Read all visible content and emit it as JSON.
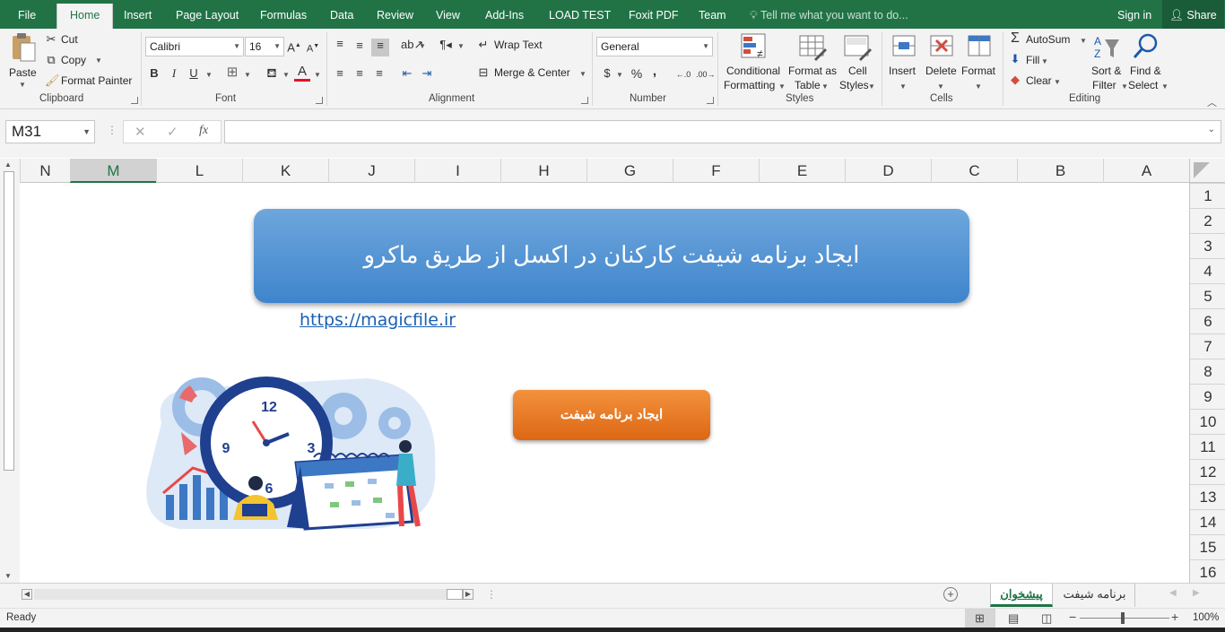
{
  "menu": {
    "tabs": [
      "File",
      "Home",
      "Insert",
      "Page Layout",
      "Formulas",
      "Data",
      "Review",
      "View",
      "Add-Ins",
      "LOAD TEST",
      "Foxit PDF",
      "Team"
    ],
    "active_tab": "Home",
    "tell_me": "Tell me what you want to do...",
    "sign_in": "Sign in",
    "share": "Share"
  },
  "ribbon": {
    "clipboard": {
      "paste": "Paste",
      "cut": "Cut",
      "copy": "Copy",
      "format_painter": "Format Painter",
      "label": "Clipboard"
    },
    "font": {
      "name": "Calibri",
      "size": "16",
      "bold": "B",
      "italic": "I",
      "underline": "U",
      "label": "Font",
      "font_color": "#e81123"
    },
    "alignment": {
      "wrap_text": "Wrap Text",
      "merge_center": "Merge & Center",
      "label": "Alignment"
    },
    "number": {
      "format": "General",
      "currency": "$",
      "percent": "%",
      "comma": ",",
      "label": "Number"
    },
    "styles": {
      "conditional": "Conditional",
      "formatting": "Formatting",
      "format_as": "Format as",
      "table": "Table",
      "cell": "Cell",
      "cell_styles": "Styles",
      "label": "Styles"
    },
    "cells": {
      "insert": "Insert",
      "delete": "Delete",
      "format": "Format",
      "label": "Cells"
    },
    "editing": {
      "autosum": "AutoSum",
      "fill": "Fill",
      "clear": "Clear",
      "sort": "Sort &",
      "filter": "Filter",
      "find": "Find &",
      "select": "Select",
      "label": "Editing"
    }
  },
  "formula_bar": {
    "name_box": "M31",
    "fx": "fx",
    "value": ""
  },
  "grid": {
    "columns": [
      "N",
      "M",
      "L",
      "K",
      "J",
      "I",
      "H",
      "G",
      "F",
      "E",
      "D",
      "C",
      "B",
      "A"
    ],
    "selected_column": "M",
    "rows": [
      "1",
      "2",
      "3",
      "4",
      "5",
      "6",
      "7",
      "8",
      "9",
      "10",
      "11",
      "12",
      "13",
      "14",
      "15",
      "16"
    ]
  },
  "content": {
    "title": "ایجاد برنامه شیفت کارکنان در اکسل از طریق ماکرو",
    "link": "https://magicfile.ir",
    "button": "ایجاد برنامه شیفت",
    "clock_numbers": [
      "12",
      "3",
      "6",
      "9"
    ]
  },
  "sheets": {
    "tabs": [
      "پیشخوان",
      "برنامه شیفت"
    ],
    "active": "پیشخوان"
  },
  "status": {
    "ready": "Ready",
    "zoom": "100%"
  },
  "colors": {
    "excel_green": "#217346",
    "title_blue": "#4a8fd3",
    "button_orange": "#ea7a28",
    "link_blue": "#1a5fb4"
  }
}
